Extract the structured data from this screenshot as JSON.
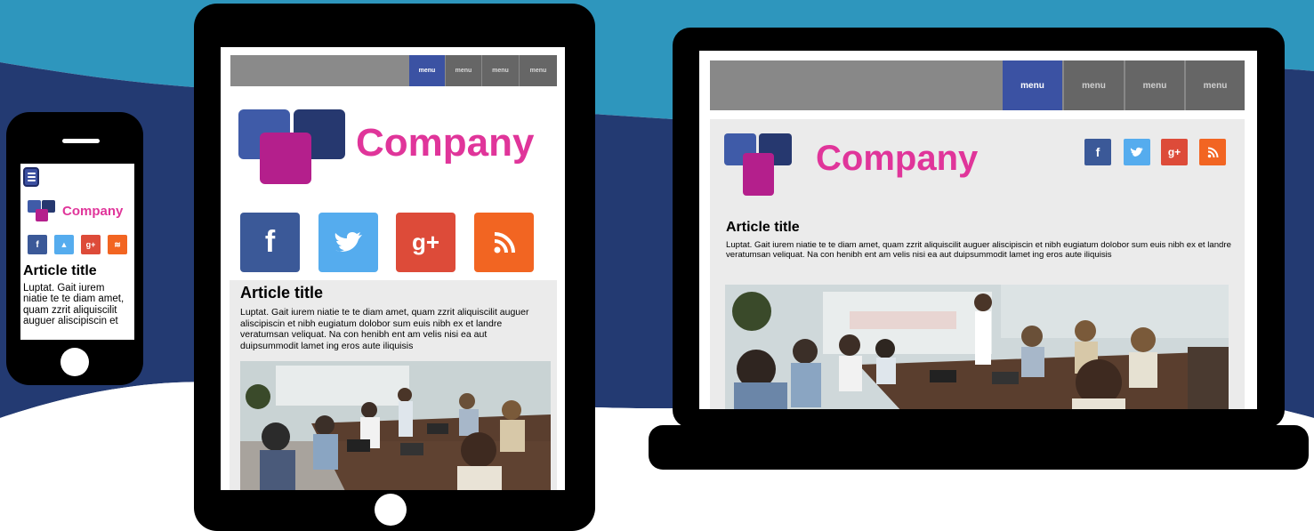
{
  "colors": {
    "sky": "#2e96bd",
    "wave": "#233a72",
    "menu_active": "#3b52a3",
    "menu_inactive": "#666666",
    "brand_pink": "#e0359a",
    "logo_blue_light": "#3f5ba8",
    "logo_blue_dark": "#26386f",
    "logo_magenta": "#b41f8c",
    "facebook": "#3b5998",
    "twitter": "#55acee",
    "googleplus": "#dd4b39",
    "rss": "#f26522"
  },
  "social_icons": [
    "facebook-icon",
    "twitter-icon",
    "google-plus-icon",
    "rss-icon"
  ],
  "phone": {
    "company": "Company",
    "article_title": "Article title",
    "article_body": "Luptat. Gait iurem niatie te te diam amet, quam zzrit aliquiscilit auguer aliscipiscin et"
  },
  "tablet": {
    "menu": [
      "menu",
      "menu",
      "menu",
      "menu"
    ],
    "company": "Company",
    "article_title": "Article title",
    "article_body": "Luptat. Gait iurem niatie te te diam amet, quam zzrit aliquiscilit auguer aliscipiscin et nibh eugiatum dolobor sum euis nibh ex et landre veratumsan veliquat. Na con henibh ent am velis nisi ea aut duipsummodit lamet ing eros aute  iliquisis"
  },
  "laptop": {
    "menu": [
      "menu",
      "menu",
      "menu",
      "menu"
    ],
    "company": "Company",
    "article_title": "Article title",
    "article_body": "Luptat. Gait iurem niatie te te diam amet, quam zzrit aliquiscilit auguer aliscipiscin et nibh eugiatum dolobor sum euis nibh ex et landre veratumsan veliquat. Na con henibh ent am velis nisi ea aut duipsummodit lamet ing eros aute  iliquisis"
  }
}
